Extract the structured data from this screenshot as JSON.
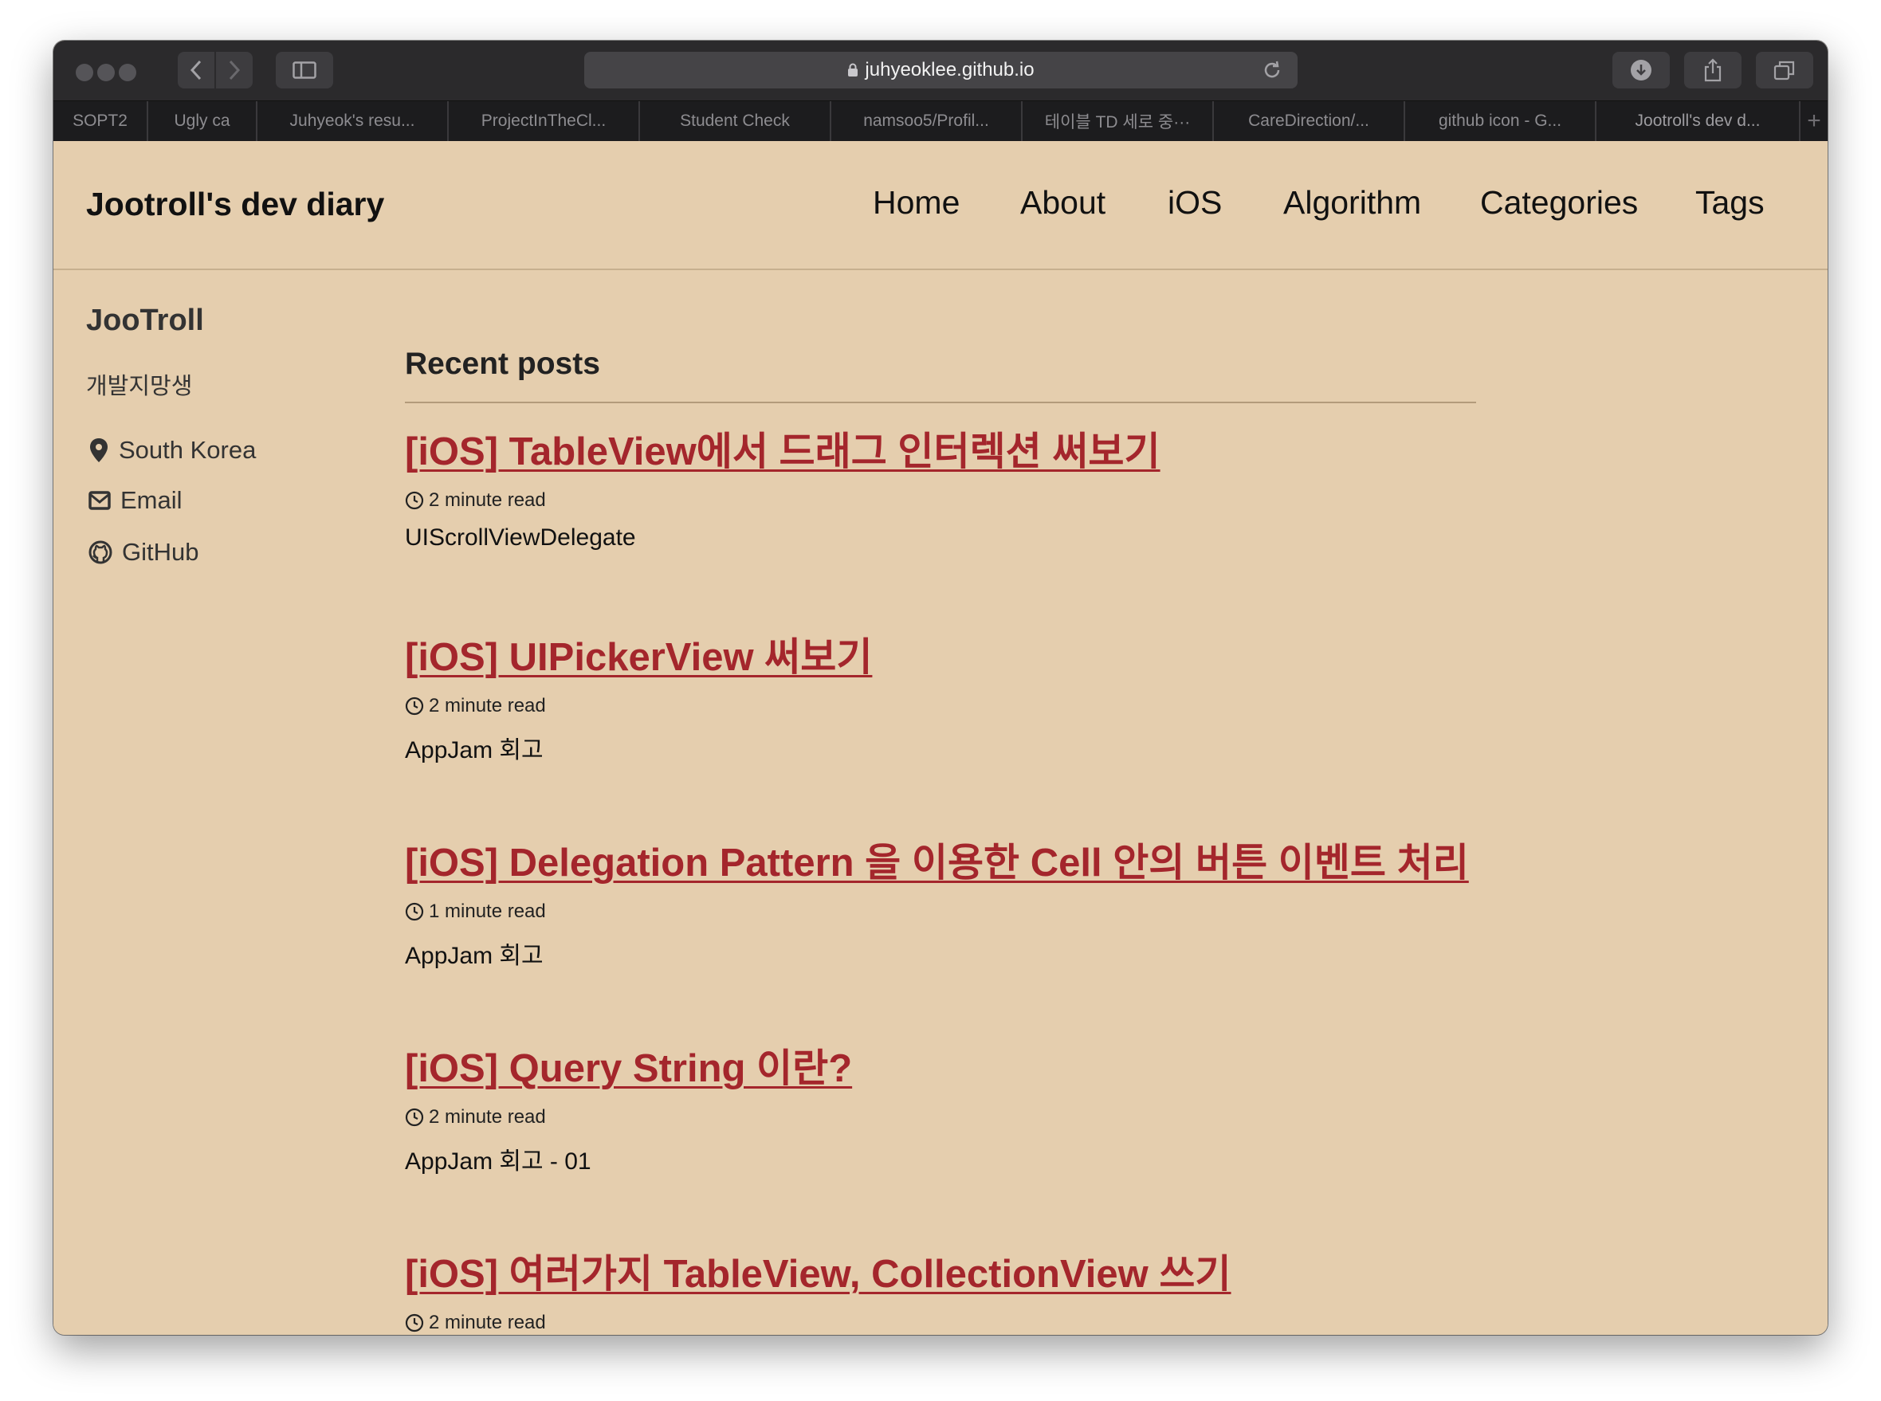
{
  "browser": {
    "url": "juhyeoklee.github.io",
    "tabs": [
      "SOPT2",
      "Ugly ca",
      "Juhyeok's resu...",
      "ProjectInTheCl...",
      "Student Check",
      "namsoo5/Profil...",
      "테이블 TD 세로 중···",
      "CareDirection/...",
      "github icon - G...",
      "Jootroll's dev d..."
    ]
  },
  "site": {
    "title": "Jootroll's dev diary",
    "nav": [
      "Home",
      "About",
      "iOS",
      "Algorithm",
      "Categories",
      "Tags"
    ]
  },
  "author": {
    "name": "JooTroll",
    "bio": "개발지망생",
    "links": {
      "location": "South Korea",
      "email": "Email",
      "github": "GitHub"
    }
  },
  "main": {
    "heading": "Recent posts",
    "posts": [
      {
        "title": "[iOS] TableView에서 드래그 인터렉션 써보기",
        "read_time": "2 minute read",
        "excerpt": "UIScrollViewDelegate"
      },
      {
        "title": "[iOS] UIPickerView 써보기",
        "read_time": "2 minute read",
        "excerpt": "AppJam 회고"
      },
      {
        "title": "[iOS] Delegation Pattern 을 이용한 Cell 안의 버튼 이벤트 처리",
        "read_time": "1 minute read",
        "excerpt": "AppJam 회고"
      },
      {
        "title": "[iOS] Query String 이란?",
        "read_time": "2 minute read",
        "excerpt": "AppJam 회고 - 01"
      },
      {
        "title": "[iOS] 여러가지 TableView, CollectionView 쓰기",
        "read_time": "2 minute read",
        "excerpt": ""
      }
    ]
  },
  "colors": {
    "page_background": "#e5ceae",
    "post_link": "#a4262c",
    "toolbar": "#2b2a2c"
  },
  "icons": {
    "location": "map-marker-icon",
    "email": "envelope-icon",
    "github": "github-icon",
    "read_time": "clock-icon"
  }
}
